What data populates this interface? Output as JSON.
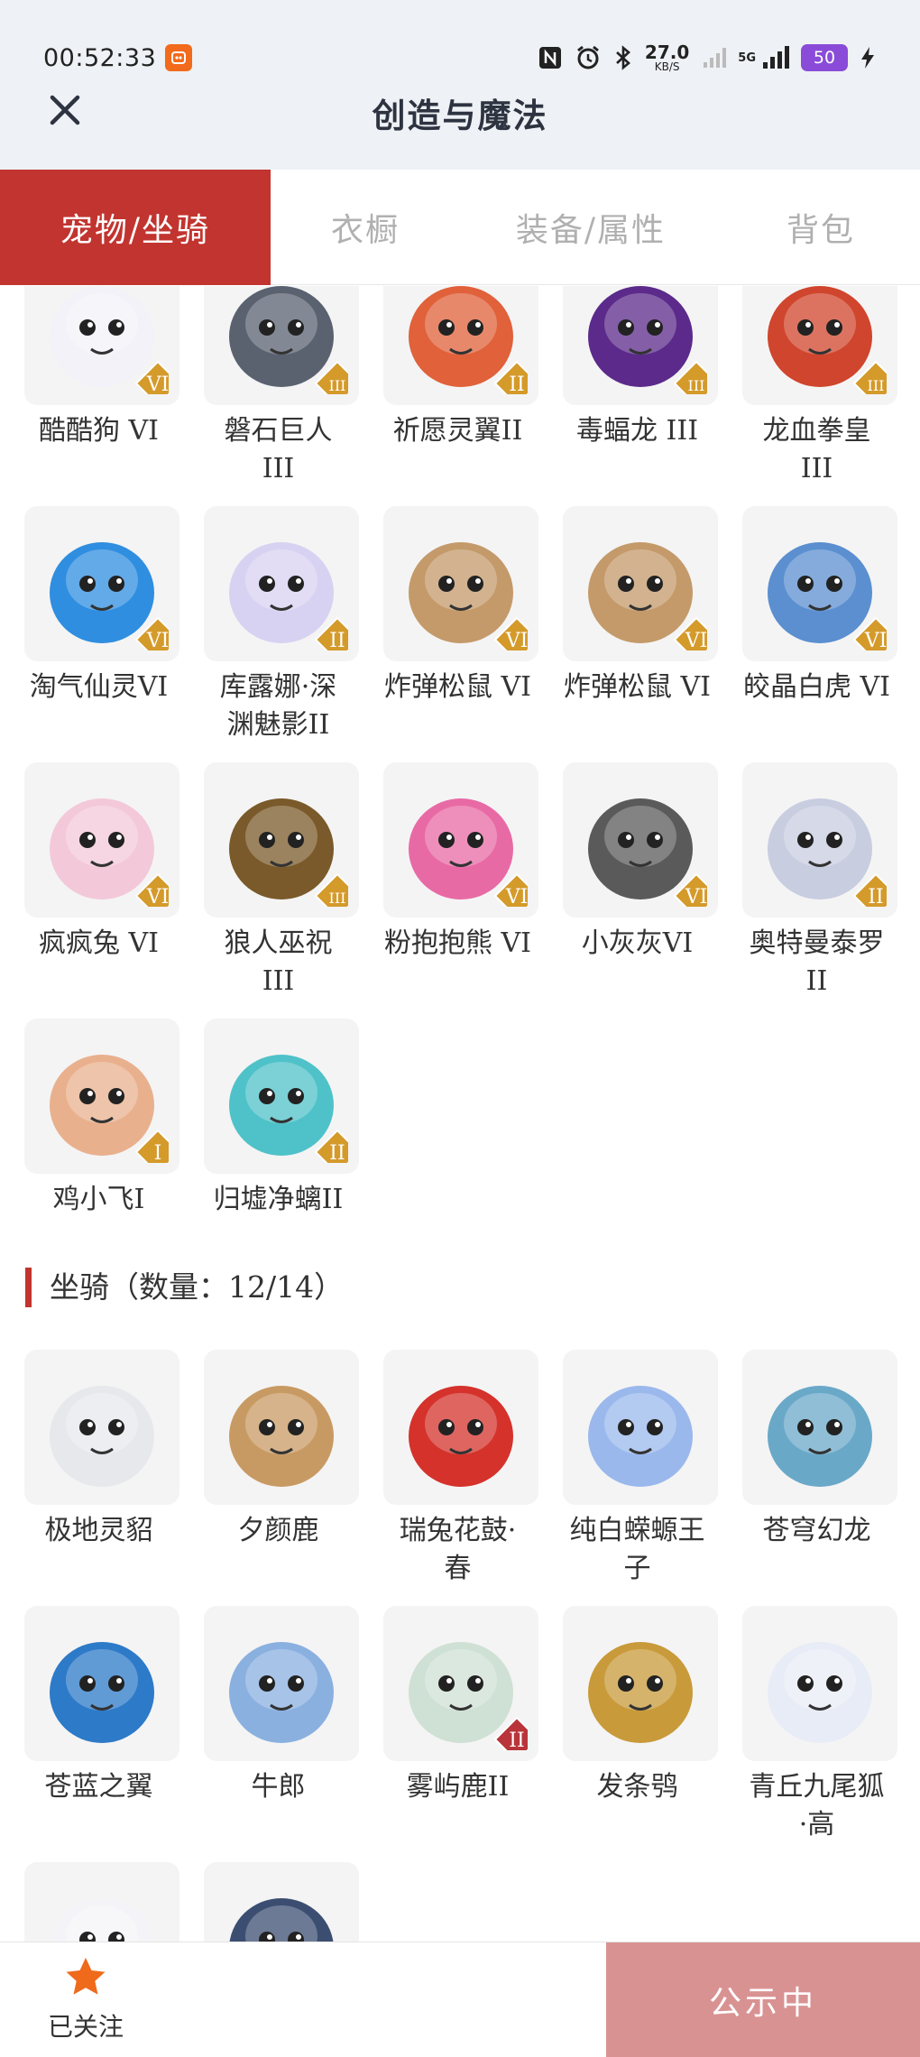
{
  "status_bar": {
    "time": "00:52:33",
    "network_speed": "27.0",
    "network_unit": "KB/S",
    "signal_label": "5G",
    "battery": "50"
  },
  "header": {
    "title": "创造与魔法"
  },
  "tabs": [
    {
      "label": "宠物/坐骑",
      "active": true
    },
    {
      "label": "衣橱",
      "active": false
    },
    {
      "label": "装备/属性",
      "active": false
    },
    {
      "label": "背包",
      "active": false
    }
  ],
  "pets": [
    {
      "name": "酷酷狗 VI",
      "tier": "VI",
      "icon": "dog-goggles-icon",
      "color": "#f2f2f8"
    },
    {
      "name": "磐石巨人\nIII",
      "tier": "III",
      "icon": "rock-giant-icon",
      "color": "#5a6270"
    },
    {
      "name": "祈愿灵翼II",
      "tier": "II",
      "icon": "eagle-icon",
      "color": "#e0613a"
    },
    {
      "name": "毒蝠龙 III",
      "tier": "III",
      "icon": "bat-dragon-icon",
      "color": "#5b2a8a"
    },
    {
      "name": "龙血拳皇\nIII",
      "tier": "III",
      "icon": "red-dragon-icon",
      "color": "#d0452d"
    },
    {
      "name": "淘气仙灵VI",
      "tier": "VI",
      "icon": "blue-pup-icon",
      "color": "#2f8ee0"
    },
    {
      "name": "库露娜·深\n渊魅影II",
      "tier": "II",
      "icon": "fairy-icon",
      "color": "#d8d2f2"
    },
    {
      "name": "炸弹松鼠 VI",
      "tier": "VI",
      "icon": "squirrel-icon",
      "color": "#c49a6a"
    },
    {
      "name": "炸弹松鼠 VI",
      "tier": "VI",
      "icon": "squirrel-icon",
      "color": "#c49a6a"
    },
    {
      "name": "皎晶白虎 VI",
      "tier": "VI",
      "icon": "white-tiger-icon",
      "color": "#5b8fd0"
    },
    {
      "name": "疯疯兔 VI",
      "tier": "VI",
      "icon": "rabbit-icon",
      "color": "#f3c9d9"
    },
    {
      "name": "狼人巫祝\nIII",
      "tier": "III",
      "icon": "werewolf-icon",
      "color": "#7a5a2a"
    },
    {
      "name": "粉抱抱熊 VI",
      "tier": "VI",
      "icon": "pink-bear-icon",
      "color": "#e86aa5"
    },
    {
      "name": "小灰灰VI",
      "tier": "VI",
      "icon": "grey-wolf-icon",
      "color": "#5a5a5a"
    },
    {
      "name": "奥特曼泰罗\nII",
      "tier": "II",
      "icon": "ultraman-icon",
      "color": "#c8cde0"
    },
    {
      "name": "鸡小飞I",
      "tier": "I",
      "icon": "chick-icon",
      "color": "#e9b08e"
    },
    {
      "name": "归墟净螭II",
      "tier": "II",
      "icon": "water-dragon-icon",
      "color": "#4fc2c9"
    }
  ],
  "mounts_section": {
    "title": "坐骑（数量：12/14）"
  },
  "mounts": [
    {
      "name": "极地灵貂",
      "tier": "",
      "icon": "white-fox-icon",
      "color": "#e6e8ec"
    },
    {
      "name": "夕颜鹿",
      "tier": "",
      "icon": "deer-icon",
      "color": "#c89a63"
    },
    {
      "name": "瑞兔花鼓·\n春",
      "tier": "",
      "icon": "drum-icon",
      "color": "#d4322b"
    },
    {
      "name": "纯白蝾螈王\n子",
      "tier": "",
      "icon": "axolotl-icon",
      "color": "#9ab8ec"
    },
    {
      "name": "苍穹幻龙",
      "tier": "",
      "icon": "sky-dragon-icon",
      "color": "#6aa8c8"
    },
    {
      "name": "苍蓝之翼",
      "tier": "",
      "icon": "blue-wing-icon",
      "color": "#2d7ac8"
    },
    {
      "name": "牛郎",
      "tier": "",
      "icon": "ox-icon",
      "color": "#8ab0e0"
    },
    {
      "name": "雾屿鹿II",
      "tier": "II",
      "icon": "mist-deer-icon",
      "color": "#cfe0d4"
    },
    {
      "name": "发条鸮",
      "tier": "",
      "icon": "owl-icon",
      "color": "#c89a3a"
    },
    {
      "name": "青丘九尾狐\n·高",
      "tier": "",
      "icon": "nine-tail-fox-icon",
      "color": "#e8ecf6"
    },
    {
      "name": "",
      "tier": "",
      "icon": "bunny-mount-icon",
      "color": "#f4f4f8"
    },
    {
      "name": "",
      "tier": "",
      "icon": "shark-fin-icon",
      "color": "#3b4e72"
    }
  ],
  "bottom_bar": {
    "follow_label": "已关注",
    "status_button": "公示中"
  },
  "colors": {
    "accent": "#c2342f",
    "tier_badge": "#d49a2a",
    "tier_badge_red": "#b8343a",
    "button_bg": "#d99292"
  }
}
